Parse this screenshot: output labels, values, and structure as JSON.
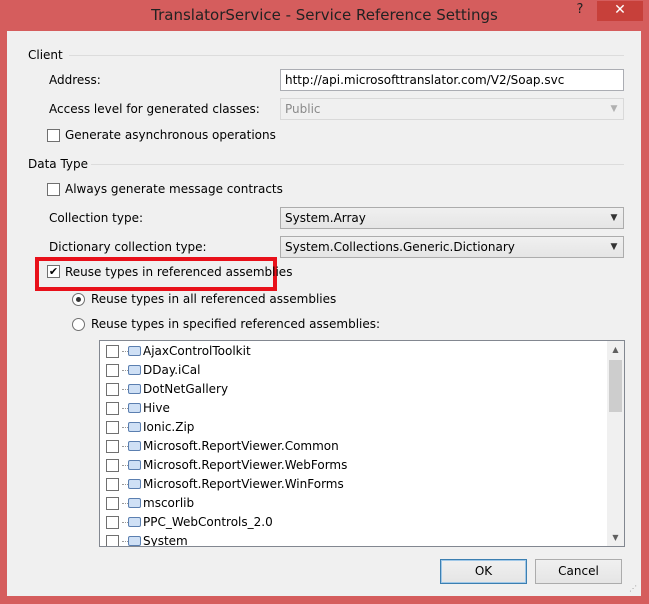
{
  "window": {
    "title": "TranslatorService - Service Reference Settings",
    "help_label": "?",
    "close_label": "✕"
  },
  "client_group": {
    "label": "Client",
    "address_label": "Address:",
    "address_value": "http://api.microsofttranslator.com/V2/Soap.svc",
    "access_level_label": "Access level for generated classes:",
    "access_level_value": "Public",
    "async_label": "Generate asynchronous operations",
    "async_checked": false
  },
  "data_type_group": {
    "label": "Data Type",
    "message_contracts_label": "Always generate message contracts",
    "message_contracts_checked": false,
    "collection_type_label": "Collection type:",
    "collection_type_value": "System.Array",
    "dictionary_type_label": "Dictionary collection type:",
    "dictionary_type_value": "System.Collections.Generic.Dictionary",
    "reuse_types_label": "Reuse types in referenced assemblies",
    "reuse_types_checked": true,
    "reuse_all_label": "Reuse types in all referenced assemblies",
    "reuse_all_selected": true,
    "reuse_specified_label": "Reuse types in specified referenced assemblies:",
    "reuse_specified_selected": false
  },
  "assemblies": [
    {
      "name": "AjaxControlToolkit",
      "checked": false
    },
    {
      "name": "DDay.iCal",
      "checked": false
    },
    {
      "name": "DotNetGallery",
      "checked": false
    },
    {
      "name": "Hive",
      "checked": false
    },
    {
      "name": "Ionic.Zip",
      "checked": false
    },
    {
      "name": "Microsoft.ReportViewer.Common",
      "checked": false
    },
    {
      "name": "Microsoft.ReportViewer.WebForms",
      "checked": false
    },
    {
      "name": "Microsoft.ReportViewer.WinForms",
      "checked": false
    },
    {
      "name": "mscorlib",
      "checked": false
    },
    {
      "name": "PPC_WebControls_2.0",
      "checked": false
    },
    {
      "name": "System",
      "checked": false
    }
  ],
  "buttons": {
    "ok_label": "OK",
    "cancel_label": "Cancel"
  },
  "icons": {
    "dropdown": "chevron-down-icon",
    "assembly": "assembly-icon",
    "scroll_up": "scroll-up-icon",
    "scroll_down": "scroll-down-icon"
  },
  "colors": {
    "title_bar": "#d55d5d",
    "close_button": "#c7403a",
    "highlight_box": "#e8101a"
  }
}
